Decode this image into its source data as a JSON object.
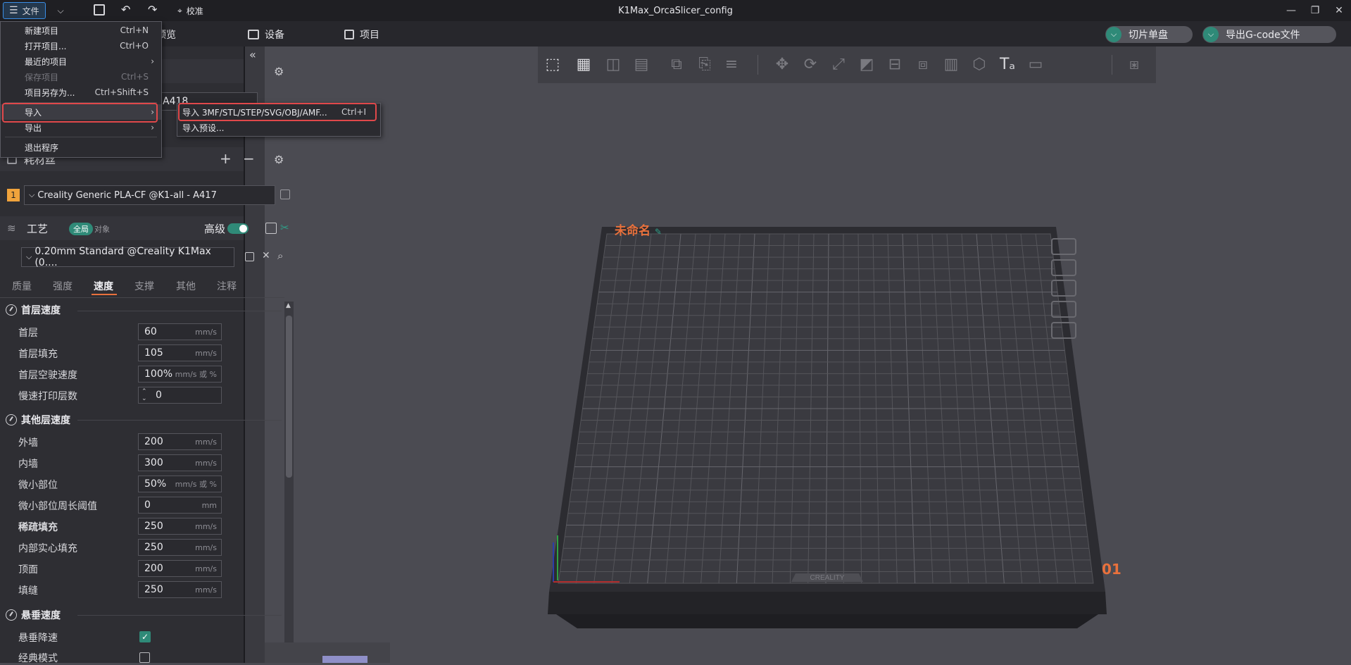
{
  "titlebar": {
    "file_label": "文件",
    "calibrate_label": "校准",
    "window_title": "K1Max_OrcaSlicer_config"
  },
  "tabs": {
    "preview": "预览",
    "device": "设备",
    "project": "项目",
    "slice_plate": "切片单盘",
    "export_gcode": "导出G-code文件"
  },
  "file_menu": {
    "items": [
      {
        "label": "新建项目",
        "shortcut": "Ctrl+N"
      },
      {
        "label": "打开项目...",
        "shortcut": "Ctrl+O"
      },
      {
        "label": "最近的项目",
        "shortcut": ""
      },
      {
        "label": "保存项目",
        "shortcut": "Ctrl+S"
      },
      {
        "label": "项目另存为...",
        "shortcut": "Ctrl+Shift+S"
      },
      {
        "label": "导入",
        "shortcut": ""
      },
      {
        "label": "导出",
        "shortcut": ""
      },
      {
        "label": "退出程序",
        "shortcut": ""
      }
    ]
  },
  "import_submenu": {
    "items": [
      {
        "label": "导入 3MF/STL/STEP/SVG/OBJ/AMF...",
        "shortcut": "Ctrl+I"
      },
      {
        "label": "导入预设..."
      }
    ]
  },
  "printer": {
    "partial_name": "A418"
  },
  "filament": {
    "title": "耗材丝",
    "slot": "1",
    "preset": "Creality Generic PLA-CF @K1-all - A417"
  },
  "process": {
    "title": "工艺",
    "global": "全局",
    "object": "对象",
    "advanced": "高级",
    "preset": "0.20mm Standard @Creality K1Max (0...."
  },
  "subtabs": [
    "质量",
    "强度",
    "速度",
    "支撑",
    "其他",
    "注释"
  ],
  "speed": {
    "first_layer_title": "首层速度",
    "first_layer_fields": [
      {
        "label": "首层",
        "value": "60",
        "unit": "mm/s"
      },
      {
        "label": "首层填充",
        "value": "105",
        "unit": "mm/s"
      },
      {
        "label": "首层空驶速度",
        "value": "100%",
        "unit": "mm/s 或 %"
      },
      {
        "label": "慢速打印层数",
        "value": "0",
        "unit": ""
      }
    ],
    "other_layer_title": "其他层速度",
    "other_layer_fields": [
      {
        "label": "外墙",
        "value": "200",
        "unit": "mm/s"
      },
      {
        "label": "内墙",
        "value": "300",
        "unit": "mm/s"
      },
      {
        "label": "微小部位",
        "value": "50%",
        "unit": "mm/s 或 %"
      },
      {
        "label": "微小部位周长阈值",
        "value": "0",
        "unit": "mm"
      },
      {
        "label": "稀疏填充",
        "value": "250",
        "unit": "mm/s"
      },
      {
        "label": "内部实心填充",
        "value": "250",
        "unit": "mm/s"
      },
      {
        "label": "顶面",
        "value": "200",
        "unit": "mm/s"
      },
      {
        "label": "填缝",
        "value": "250",
        "unit": "mm/s"
      }
    ],
    "overhang_title": "悬垂速度",
    "overhang_fields": [
      {
        "label": "悬垂降速",
        "checked": true
      },
      {
        "label": "经典模式",
        "checked": false
      }
    ]
  },
  "plate": {
    "name": "未命名",
    "number": "01",
    "brand": "CREALITY"
  },
  "colors": {
    "accent": "#2f8a78",
    "highlight": "#e0484a",
    "orange": "#e9713c"
  }
}
